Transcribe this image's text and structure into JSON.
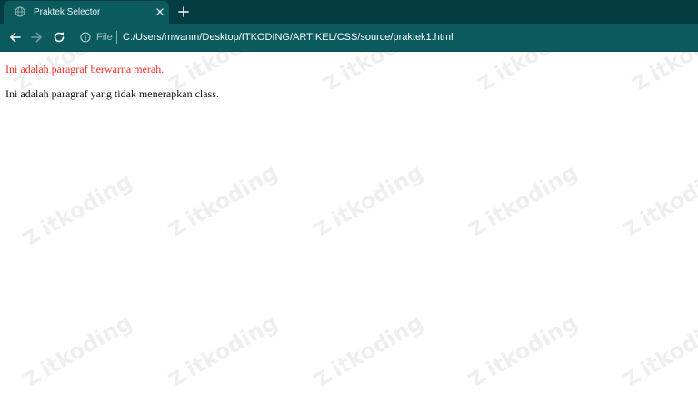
{
  "tab": {
    "title": "Praktek Selector",
    "favicon": "globe-icon",
    "close_icon": "close-icon"
  },
  "new_tab_icon": "plus-icon",
  "toolbar": {
    "back_icon": "arrow-left-icon",
    "forward_icon": "arrow-right-icon",
    "reload_icon": "reload-icon",
    "info_icon": "info-icon",
    "scheme_label": "File",
    "url": "C:/Users/mwanm/Desktop/ITKODING/ARTIKEL/CSS/source/praktek1.html"
  },
  "page": {
    "paragraphs": [
      {
        "text": "Ini adalah paragraf berwarna merah.",
        "color": "#ff2a2a"
      },
      {
        "text": "Ini adalah paragraf yang tidak menerapkan class.",
        "color": "#111111"
      }
    ]
  },
  "watermark": "itkoding",
  "colors": {
    "tabstrip": "#033c42",
    "toolbar": "#0a5a5e",
    "page_bg": "#ffffff"
  }
}
